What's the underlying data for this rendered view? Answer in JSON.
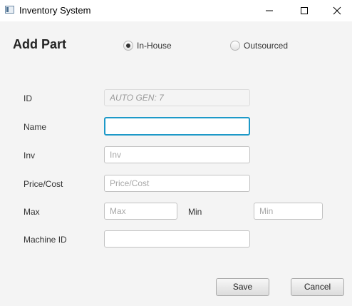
{
  "window": {
    "title": "Inventory System",
    "controls": {
      "minimize": "minimize-icon",
      "maximize": "maximize-icon",
      "close": "close-icon"
    }
  },
  "form": {
    "heading": "Add Part",
    "source_options": [
      {
        "label": "In-House",
        "checked": true
      },
      {
        "label": "Outsourced",
        "checked": false
      }
    ],
    "fields": {
      "id": {
        "label": "ID",
        "value": "",
        "placeholder": "AUTO GEN: 7"
      },
      "name": {
        "label": "Name",
        "value": "",
        "placeholder": ""
      },
      "inv": {
        "label": "Inv",
        "value": "",
        "placeholder": "Inv"
      },
      "price": {
        "label": "Price/Cost",
        "value": "",
        "placeholder": "Price/Cost"
      },
      "max": {
        "label": "Max",
        "value": "",
        "placeholder": "Max"
      },
      "min": {
        "label": "Min",
        "value": "",
        "placeholder": "Min"
      },
      "machine_id": {
        "label": "Machine ID",
        "value": "",
        "placeholder": ""
      }
    },
    "buttons": {
      "save": "Save",
      "cancel": "Cancel"
    }
  }
}
